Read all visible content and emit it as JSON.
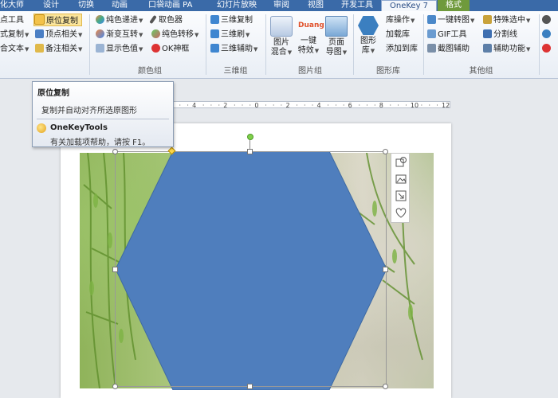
{
  "tabs": [
    "化大师",
    "设计",
    "切换",
    "动画",
    "口袋动画 PA",
    "幻灯片放映",
    "审阅",
    "视图",
    "开发工具",
    "OneKey 7",
    "格式"
  ],
  "active_tab": "OneKey 7",
  "ribbon": {
    "col1": [
      "点工具",
      "式复制",
      "合文本"
    ],
    "col2": [
      "原位复制",
      "顶点相关",
      "备注相关"
    ],
    "col3": [
      "纯色递进",
      "渐变互转",
      "显示色值"
    ],
    "col4": [
      "取色器",
      "纯色转移",
      "OK神框"
    ],
    "group_color": "颜色组",
    "col5": [
      "三维复制",
      "三维刷",
      "三维辅助"
    ],
    "group_3d": "三维组",
    "big1": [
      "图片",
      "混合"
    ],
    "big2_caption": "Duang",
    "big2": [
      "一键",
      "特效"
    ],
    "big3": [
      "页面",
      "导图"
    ],
    "group_image": "图片组",
    "big4": [
      "图形",
      "库"
    ],
    "col6": [
      "库操作",
      "加载库",
      "添加到库"
    ],
    "group_lib": "图形库",
    "col7": [
      "一键转图",
      "GIF工具",
      "截图辅助"
    ],
    "col8": [
      "特殊选中",
      "分割线",
      "辅助功能"
    ],
    "group_other": "其他组"
  },
  "tooltip": {
    "title": "原位复制",
    "desc": "复制并自动对齐所选原图形",
    "brand": "OneKeyTools",
    "help": "有关加载项帮助，请按 F1。"
  },
  "ruler": {
    "ticks": [
      "6",
      "4",
      "2",
      "0",
      "2",
      "4",
      "6",
      "8",
      "10",
      "12"
    ]
  },
  "colors": {
    "hexagon": "#4f7ebd",
    "tabbar": "#3a6aa8",
    "highlight": "#fbe59b"
  },
  "side_tools": [
    "crop-shape-icon",
    "image-icon",
    "resize-icon",
    "heart-icon"
  ]
}
